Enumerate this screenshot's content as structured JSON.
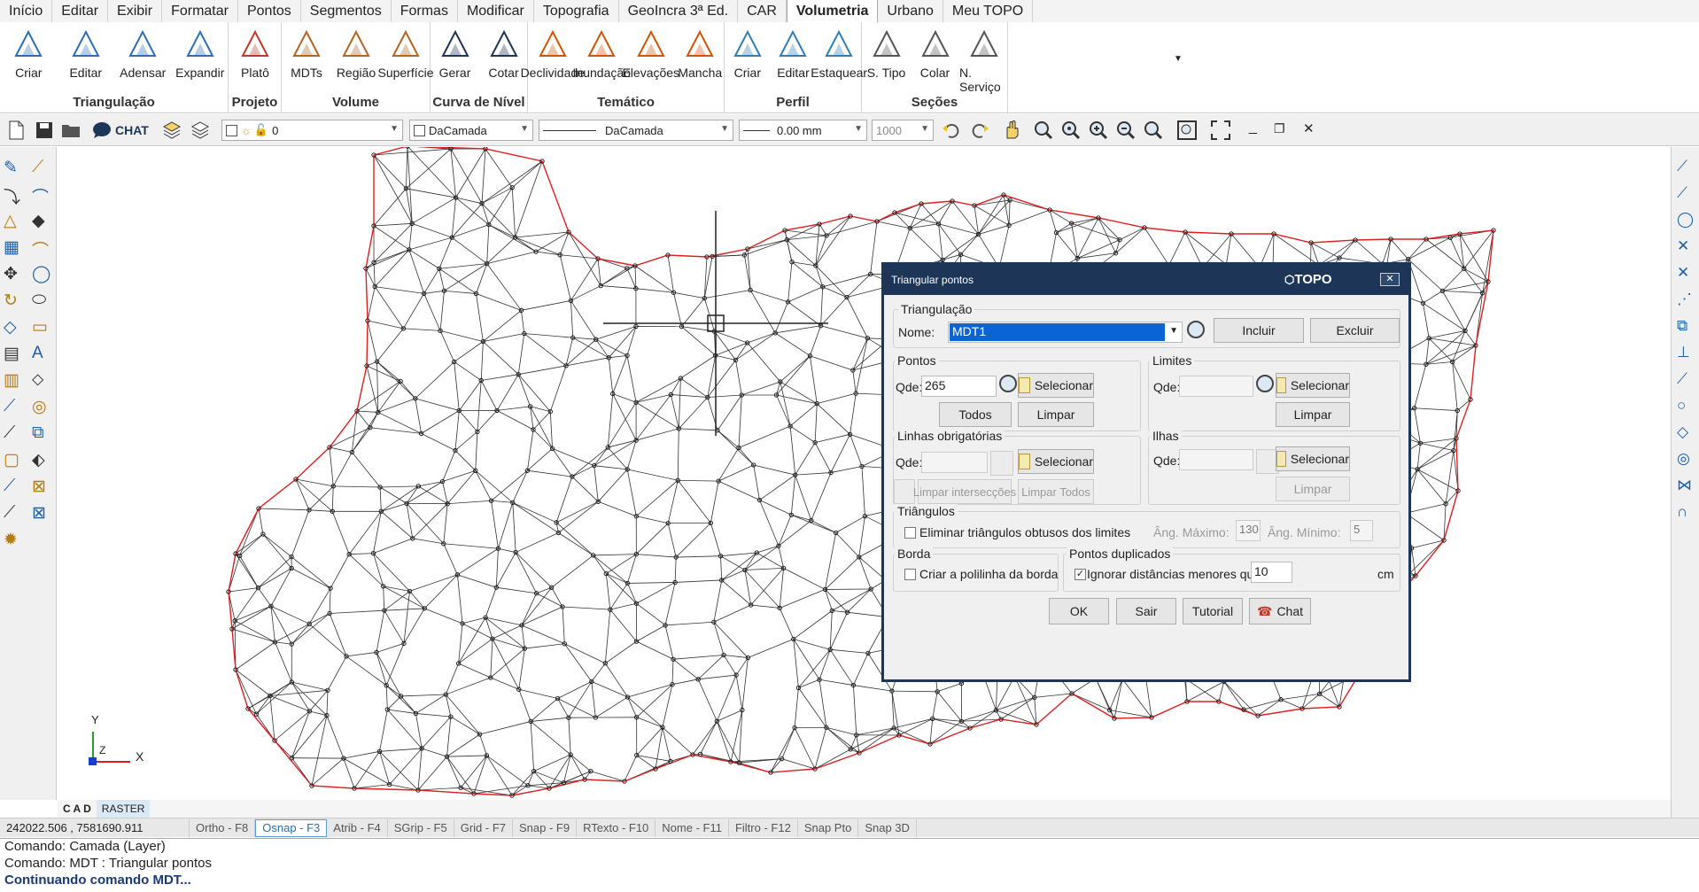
{
  "menu_tabs": [
    "Início",
    "Editar",
    "Exibir",
    "Formatar",
    "Pontos",
    "Segmentos",
    "Formas",
    "Modificar",
    "Topografia",
    "GeoIncra 3ª Ed.",
    "CAR",
    "Volumetria",
    "Urbano",
    "Meu TOPO"
  ],
  "active_tab": "Volumetria",
  "ribbon": {
    "groups": [
      {
        "label": "Triangulação",
        "buttons": [
          "Criar",
          "Editar",
          "Adensar",
          "Expandir"
        ]
      },
      {
        "label": "Projeto",
        "buttons": [
          "Platô"
        ]
      },
      {
        "label": "Volume",
        "buttons": [
          "MDTs",
          "Região",
          "Superfície"
        ]
      },
      {
        "label": "Curva de Nível",
        "buttons": [
          "Gerar",
          "Cotar"
        ]
      },
      {
        "label": "Temático",
        "buttons": [
          "Declividade",
          "Inundação",
          "Elevações",
          "Mancha"
        ]
      },
      {
        "label": "Perfil",
        "buttons": [
          "Criar",
          "Editar",
          "Estaquear"
        ]
      },
      {
        "label": "Seções",
        "buttons": [
          "S. Tipo",
          "Colar",
          "N. Serviço"
        ]
      }
    ]
  },
  "toolbar": {
    "chat_label": "CHAT",
    "layer_value": "0",
    "color_value": "DaCamada",
    "linetype_value": "DaCamada",
    "lineweight_value": "0.00 mm",
    "scale_value": "1000"
  },
  "cad_tabs": {
    "cad": "C A D",
    "raster": "RASTER"
  },
  "axis": {
    "y": "Y",
    "x": "X",
    "z": "Z"
  },
  "statusbar": {
    "coords": "242022.506 , 7581690.911",
    "items": [
      "Ortho - F8",
      "Osnap - F3",
      "Atrib - F4",
      "SGrip - F5",
      "Grid - F7",
      "Snap - F9",
      "RTexto - F10",
      "Nome - F11",
      "Filtro - F12",
      "Snap Pto",
      "Snap 3D"
    ],
    "active_item": "Osnap - F3"
  },
  "command_lines": [
    "Comando: Camada (Layer)",
    "Comando: MDT : Triangular pontos",
    "Continuando comando MDT..."
  ],
  "dialog": {
    "title": "Triangular pontos",
    "brand": "TOPO",
    "close": "✕",
    "triangulacao": {
      "legend": "Triangulação",
      "nome_label": "Nome:",
      "nome_value": "MDT1",
      "incluir": "Incluir",
      "excluir": "Excluir"
    },
    "pontos": {
      "legend": "Pontos",
      "qde_label": "Qde:",
      "qde_value": "265",
      "selecionar": "Selecionar",
      "todos": "Todos",
      "limpar": "Limpar"
    },
    "limites": {
      "legend": "Limites",
      "qde_label": "Qde:",
      "selecionar": "Selecionar",
      "limpar": "Limpar"
    },
    "linhas": {
      "legend": "Linhas obrigatórias",
      "qde_label": "Qde:",
      "selecionar": "Selecionar",
      "limpar_inter": "Limpar intersecções",
      "limpar_todos": "Limpar Todos"
    },
    "ilhas": {
      "legend": "Ilhas",
      "qde_label": "Qde:",
      "selecionar": "Selecionar",
      "limpar": "Limpar"
    },
    "triangulos": {
      "legend": "Triângulos",
      "eliminar_label": "Eliminar triângulos obtusos dos limites",
      "ang_max_label": "Âng. Máximo:",
      "ang_max_value": "130",
      "ang_min_label": "Âng. Mínimo:",
      "ang_min_value": "5"
    },
    "borda": {
      "legend": "Borda",
      "criar_label": "Criar a polilinha da borda"
    },
    "duplicados": {
      "legend": "Pontos duplicados",
      "ignorar_label": "Ignorar distâncias menores que:",
      "ignorar_value": "10",
      "unit": "cm",
      "checked_mark": "✓"
    },
    "buttons": {
      "ok": "OK",
      "sair": "Sair",
      "tutorial": "Tutorial",
      "chat": "Chat"
    }
  },
  "colors": {
    "dialog_frame": "#1d3557",
    "boundary": "#e02020",
    "mesh": "#333333"
  }
}
